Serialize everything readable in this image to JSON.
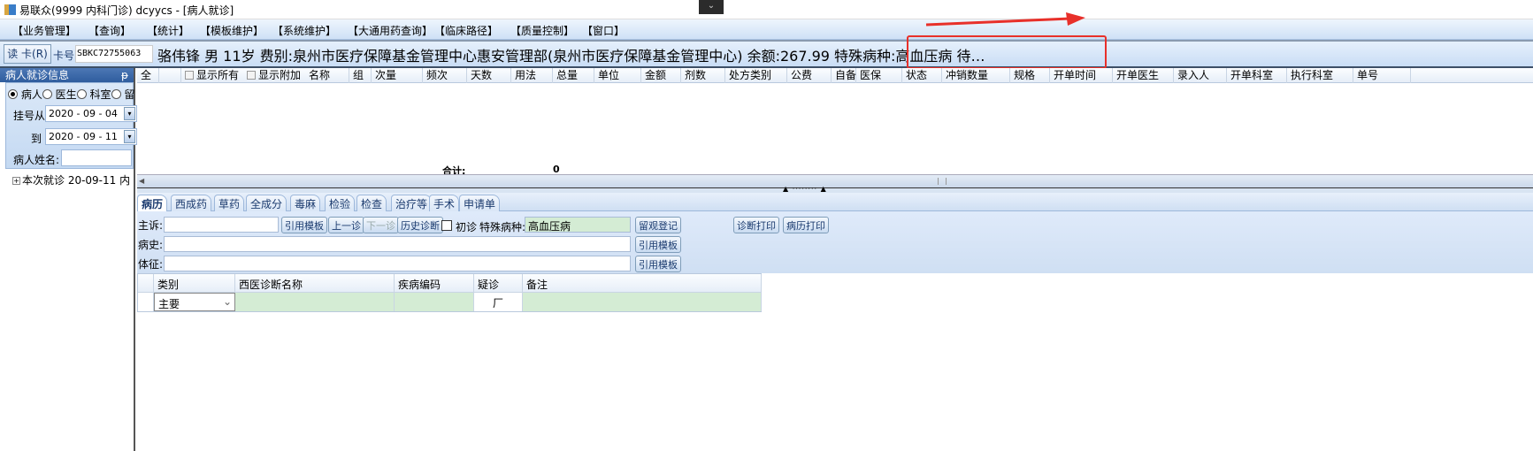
{
  "window": {
    "title": "易联众(9999 内科门诊) dcyycs - [病人就诊]"
  },
  "menu": [
    "【业务管理】",
    "【查询】",
    "【统计】",
    "【模板维护】",
    "【系统维护】",
    "【大通用药查询】",
    "【临床路径】",
    "【质量控制】",
    "【窗口】"
  ],
  "patient": {
    "read_card_label": "读 卡(R)",
    "card_label": "卡号:",
    "card_no": "SBKC72755063",
    "summary": "骆伟锋  男  11岁  费别:泉州市医疗保障基金管理中心惠安管理部(泉州市医疗保障基金管理中心) 余额:267.99 特殊病种:高血压病  待…"
  },
  "left_panel": {
    "title": "病人就诊信息",
    "pin": "ᵽ",
    "radios": [
      {
        "label": "病人",
        "checked": true
      },
      {
        "label": "医生",
        "checked": false
      },
      {
        "label": "科室",
        "checked": false
      },
      {
        "label": "留",
        "checked": false
      }
    ],
    "from_label": "挂号从",
    "from_date": "2020 - 09 - 04",
    "to_label": "到",
    "to_date": "2020 - 09 - 11",
    "name_label": "病人姓名:",
    "name_value": "",
    "tree_item": "本次就诊  20-09-11 内"
  },
  "grid": {
    "all_label": "全",
    "show_all": "显示所有",
    "show_extra": "显示附加",
    "columns": [
      "名称",
      "组",
      "次量",
      "频次",
      "天数",
      "用法",
      "总量",
      "单位",
      "金额",
      "剂数",
      "处方类别",
      "公费",
      "自备",
      "医保",
      "状态",
      "冲销数量",
      "规格",
      "开单时间",
      "开单医生",
      "录入人",
      "开单科室",
      "执行科室",
      "单号"
    ],
    "total_label": "合计:",
    "total_value": "0"
  },
  "tabs": [
    {
      "label": "病历",
      "active": true
    },
    {
      "label": "西成药"
    },
    {
      "label": "草药"
    },
    {
      "label": "全成分"
    },
    {
      "label": "毒麻"
    },
    {
      "label": "检验"
    },
    {
      "label": "检查"
    },
    {
      "label": "治疗等"
    },
    {
      "label": "手术"
    },
    {
      "label": "申请单"
    }
  ],
  "form": {
    "complaint_label": "主诉:",
    "history_label": "病史:",
    "sign_label": "体征:",
    "cite_template": "引用模板",
    "prev_visit": "上一诊",
    "next_visit": "下一诊",
    "history_diag": "历史诊断",
    "first_visit": "初诊",
    "special_label": "特殊病种:",
    "special_value": "高血压病",
    "observe": "留观登记",
    "diag_print": "诊断打印",
    "record_print": "病历打印"
  },
  "diagnosis": {
    "columns": [
      "类别",
      "西医诊断名称",
      "疾病编码",
      "疑诊",
      "备注"
    ],
    "rows": [
      {
        "category": "主要",
        "name": "",
        "code": "",
        "suspect": "厂",
        "note": ""
      }
    ]
  },
  "colors": {
    "annotation_red": "#e8302a",
    "header_blue": "#2f5d9e",
    "row_green": "#d4ecd4"
  }
}
